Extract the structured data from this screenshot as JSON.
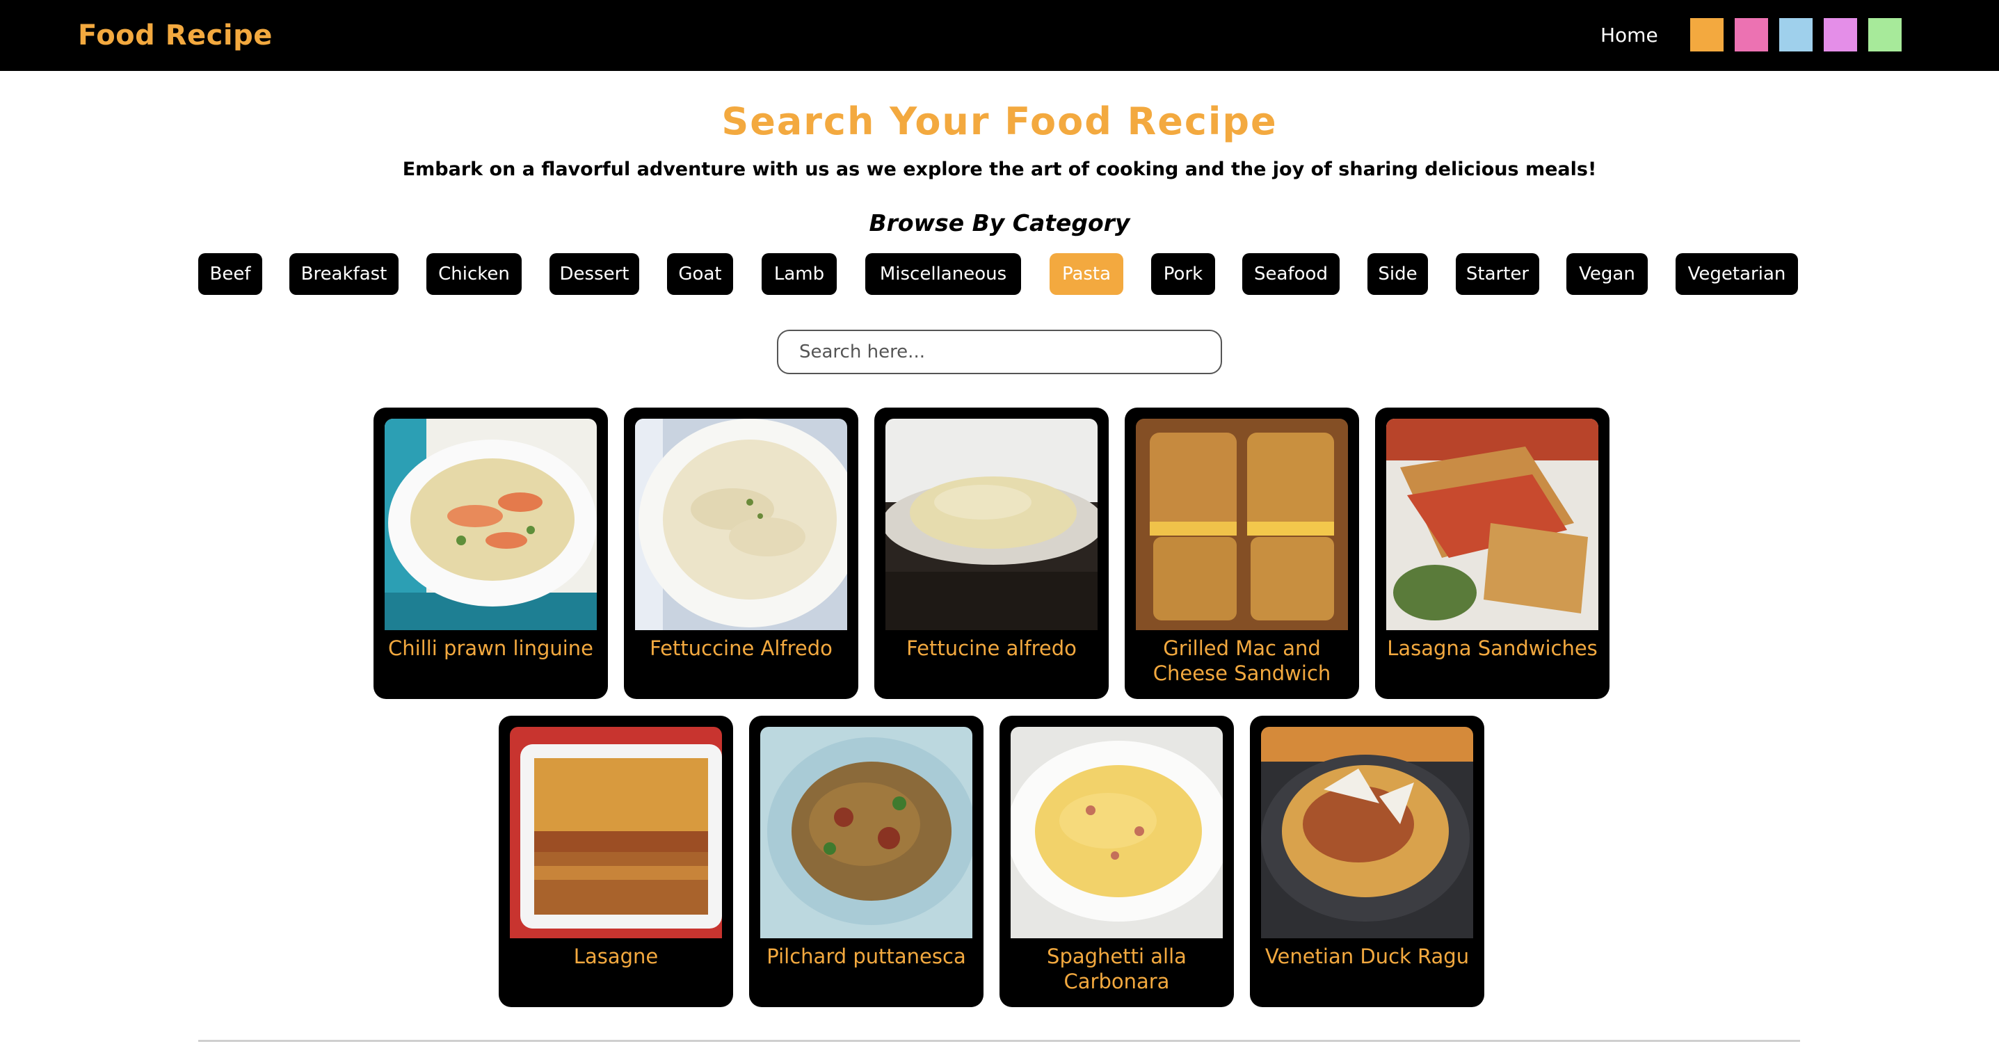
{
  "navbar": {
    "brand": "Food Recipe",
    "home_link": "Home",
    "theme_swatches": [
      {
        "name": "orange",
        "color": "#f3a93f"
      },
      {
        "name": "pink",
        "color": "#ec72b2"
      },
      {
        "name": "blue",
        "color": "#9fd0ec"
      },
      {
        "name": "violet",
        "color": "#e48ee8"
      },
      {
        "name": "green",
        "color": "#a7ea9a"
      }
    ]
  },
  "hero": {
    "title": "Search Your Food Recipe",
    "subtitle": "Embark on a flavorful adventure with us as we explore the art of cooking and the joy of sharing delicious meals!",
    "browse_heading": "Browse By Category"
  },
  "categories": [
    {
      "label": "Beef",
      "active": false
    },
    {
      "label": "Breakfast",
      "active": false
    },
    {
      "label": "Chicken",
      "active": false
    },
    {
      "label": "Dessert",
      "active": false
    },
    {
      "label": "Goat",
      "active": false
    },
    {
      "label": "Lamb",
      "active": false
    },
    {
      "label": "Miscellaneous",
      "active": false
    },
    {
      "label": "Pasta",
      "active": true
    },
    {
      "label": "Pork",
      "active": false
    },
    {
      "label": "Seafood",
      "active": false
    },
    {
      "label": "Side",
      "active": false
    },
    {
      "label": "Starter",
      "active": false
    },
    {
      "label": "Vegan",
      "active": false
    },
    {
      "label": "Vegetarian",
      "active": false
    }
  ],
  "search": {
    "placeholder": "Search here...",
    "value": ""
  },
  "recipes": [
    {
      "title": "Chilli prawn linguine",
      "image": "prawn-linguine-photo"
    },
    {
      "title": "Fettuccine Alfredo",
      "image": "fettuccine-alfredo-photo"
    },
    {
      "title": "Fettucine alfredo",
      "image": "fettucine-alfredo-photo"
    },
    {
      "title": "Grilled Mac and Cheese Sandwich",
      "image": "grilled-mac-cheese-photo"
    },
    {
      "title": "Lasagna Sandwiches",
      "image": "lasagna-sandwiches-photo"
    },
    {
      "title": "Lasagne",
      "image": "lasagne-photo"
    },
    {
      "title": "Pilchard puttanesca",
      "image": "pilchard-puttanesca-photo"
    },
    {
      "title": "Spaghetti alla Carbonara",
      "image": "spaghetti-carbonara-photo"
    },
    {
      "title": "Venetian Duck Ragu",
      "image": "venetian-duck-ragu-photo"
    }
  ],
  "colors": {
    "accent": "#f3a93f",
    "navbar_bg": "#000000",
    "card_bg": "#000000"
  }
}
